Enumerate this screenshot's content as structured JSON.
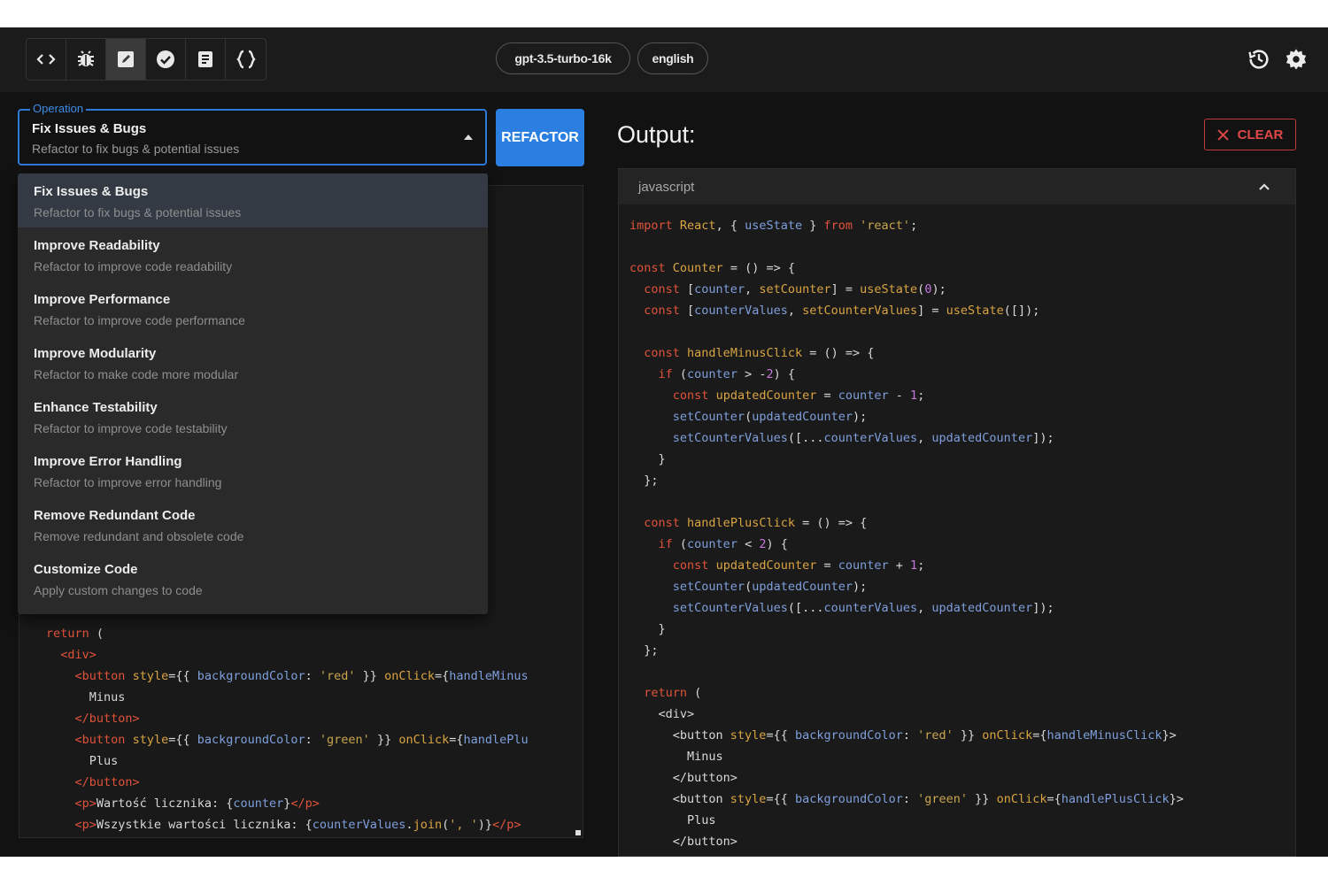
{
  "toolbar": {
    "tools": [
      {
        "icon": "code-icon"
      },
      {
        "icon": "bug-icon"
      },
      {
        "icon": "edit-icon"
      },
      {
        "icon": "check-circle-icon"
      },
      {
        "icon": "document-icon"
      },
      {
        "icon": "braces-icon"
      }
    ],
    "active_tool_index": 2,
    "model_chip": "gpt-3.5-turbo-16k",
    "language_chip": "english",
    "right_icons": [
      "history-icon",
      "gear-icon"
    ]
  },
  "operation": {
    "label": "Operation",
    "selected_title": "Fix Issues & Bugs",
    "selected_desc": "Refactor to fix bugs & potential issues",
    "button": "REFACTOR",
    "options": [
      {
        "title": "Fix Issues & Bugs",
        "desc": "Refactor to fix bugs & potential issues"
      },
      {
        "title": "Improve Readability",
        "desc": "Refactor to improve code readability"
      },
      {
        "title": "Improve Performance",
        "desc": "Refactor to improve code performance"
      },
      {
        "title": "Improve Modularity",
        "desc": "Refactor to make code more modular"
      },
      {
        "title": "Enhance Testability",
        "desc": "Refactor to improve code testability"
      },
      {
        "title": "Improve Error Handling",
        "desc": "Refactor to improve error handling"
      },
      {
        "title": "Remove Redundant Code",
        "desc": "Remove redundant and obsolete code"
      },
      {
        "title": "Customize Code",
        "desc": "Apply custom changes to code"
      }
    ]
  },
  "input_code": [
    [
      [
        "kw",
        "return"
      ],
      [
        "pl",
        " ("
      ]
    ],
    [
      [
        "pl",
        "  "
      ],
      [
        "tg",
        "<div>"
      ]
    ],
    [
      [
        "pl",
        "    "
      ],
      [
        "tg",
        "<button"
      ],
      [
        "pl",
        " "
      ],
      [
        "at",
        "style"
      ],
      [
        "pl",
        "={{ "
      ],
      [
        "vr",
        "backgroundColor"
      ],
      [
        "pl",
        ": "
      ],
      [
        "st",
        "'red'"
      ],
      [
        "pl",
        " }} "
      ],
      [
        "at",
        "onClick"
      ],
      [
        "pl",
        "={"
      ],
      [
        "vr",
        "handleMinus"
      ]
    ],
    [
      [
        "pl",
        "      Minus"
      ]
    ],
    [
      [
        "pl",
        "    "
      ],
      [
        "tg",
        "</button>"
      ]
    ],
    [
      [
        "pl",
        "    "
      ],
      [
        "tg",
        "<button"
      ],
      [
        "pl",
        " "
      ],
      [
        "at",
        "style"
      ],
      [
        "pl",
        "={{ "
      ],
      [
        "vr",
        "backgroundColor"
      ],
      [
        "pl",
        ": "
      ],
      [
        "st",
        "'green'"
      ],
      [
        "pl",
        " }} "
      ],
      [
        "at",
        "onClick"
      ],
      [
        "pl",
        "={"
      ],
      [
        "vr",
        "handlePlu"
      ]
    ],
    [
      [
        "pl",
        "      Plus"
      ]
    ],
    [
      [
        "pl",
        "    "
      ],
      [
        "tg",
        "</button>"
      ]
    ],
    [
      [
        "pl",
        "    "
      ],
      [
        "tg",
        "<p>"
      ],
      [
        "pl",
        "Wartość licznika: {"
      ],
      [
        "vr",
        "counter"
      ],
      [
        "pl",
        "}"
      ],
      [
        "tg",
        "</p>"
      ]
    ],
    [
      [
        "pl",
        "    "
      ],
      [
        "tg",
        "<p>"
      ],
      [
        "pl",
        "Wszystkie wartości licznika: {"
      ],
      [
        "vr",
        "counterValues"
      ],
      [
        "pl",
        "."
      ],
      [
        "fn",
        "join"
      ],
      [
        "pl",
        "("
      ],
      [
        "st",
        "', '"
      ],
      [
        "pl",
        ")}"
      ],
      [
        "tg",
        "</p>"
      ]
    ]
  ],
  "output": {
    "title": "Output:",
    "clear_label": "CLEAR",
    "language": "javascript",
    "code": [
      [
        [
          "kw",
          "import"
        ],
        [
          "pl",
          " "
        ],
        [
          "fn",
          "React"
        ],
        [
          "pl",
          ", { "
        ],
        [
          "vr",
          "useState"
        ],
        [
          "pl",
          " } "
        ],
        [
          "kw",
          "from"
        ],
        [
          "pl",
          " "
        ],
        [
          "st",
          "'react'"
        ],
        [
          "pl",
          ";"
        ]
      ],
      [],
      [
        [
          "kw",
          "const"
        ],
        [
          "pl",
          " "
        ],
        [
          "fn",
          "Counter"
        ],
        [
          "pl",
          " = () => {"
        ]
      ],
      [
        [
          "pl",
          "  "
        ],
        [
          "kw",
          "const"
        ],
        [
          "pl",
          " ["
        ],
        [
          "vr",
          "counter"
        ],
        [
          "pl",
          ", "
        ],
        [
          "fn",
          "setCounter"
        ],
        [
          "pl",
          "] = "
        ],
        [
          "fn",
          "useState"
        ],
        [
          "pl",
          "("
        ],
        [
          "nm",
          "0"
        ],
        [
          "pl",
          ");"
        ]
      ],
      [
        [
          "pl",
          "  "
        ],
        [
          "kw",
          "const"
        ],
        [
          "pl",
          " ["
        ],
        [
          "vr",
          "counterValues"
        ],
        [
          "pl",
          ", "
        ],
        [
          "fn",
          "setCounterValues"
        ],
        [
          "pl",
          "] = "
        ],
        [
          "fn",
          "useState"
        ],
        [
          "pl",
          "([]);"
        ]
      ],
      [],
      [
        [
          "pl",
          "  "
        ],
        [
          "kw",
          "const"
        ],
        [
          "pl",
          " "
        ],
        [
          "fn",
          "handleMinusClick"
        ],
        [
          "pl",
          " = () => {"
        ]
      ],
      [
        [
          "pl",
          "    "
        ],
        [
          "kw",
          "if"
        ],
        [
          "pl",
          " ("
        ],
        [
          "vr",
          "counter"
        ],
        [
          "pl",
          " > -"
        ],
        [
          "nm",
          "2"
        ],
        [
          "pl",
          ") {"
        ]
      ],
      [
        [
          "pl",
          "      "
        ],
        [
          "kw",
          "const"
        ],
        [
          "pl",
          " "
        ],
        [
          "fn",
          "updatedCounter"
        ],
        [
          "pl",
          " = "
        ],
        [
          "vr",
          "counter"
        ],
        [
          "pl",
          " - "
        ],
        [
          "nm",
          "1"
        ],
        [
          "pl",
          ";"
        ]
      ],
      [
        [
          "pl",
          "      "
        ],
        [
          "vr",
          "setCounter"
        ],
        [
          "pl",
          "("
        ],
        [
          "vr",
          "updatedCounter"
        ],
        [
          "pl",
          ");"
        ]
      ],
      [
        [
          "pl",
          "      "
        ],
        [
          "vr",
          "setCounterValues"
        ],
        [
          "pl",
          "([..."
        ],
        [
          "vr",
          "counterValues"
        ],
        [
          "pl",
          ", "
        ],
        [
          "vr",
          "updatedCounter"
        ],
        [
          "pl",
          "]);"
        ]
      ],
      [
        [
          "pl",
          "    }"
        ]
      ],
      [
        [
          "pl",
          "  };"
        ]
      ],
      [],
      [
        [
          "pl",
          "  "
        ],
        [
          "kw",
          "const"
        ],
        [
          "pl",
          " "
        ],
        [
          "fn",
          "handlePlusClick"
        ],
        [
          "pl",
          " = () => {"
        ]
      ],
      [
        [
          "pl",
          "    "
        ],
        [
          "kw",
          "if"
        ],
        [
          "pl",
          " ("
        ],
        [
          "vr",
          "counter"
        ],
        [
          "pl",
          " < "
        ],
        [
          "nm",
          "2"
        ],
        [
          "pl",
          ") {"
        ]
      ],
      [
        [
          "pl",
          "      "
        ],
        [
          "kw",
          "const"
        ],
        [
          "pl",
          " "
        ],
        [
          "fn",
          "updatedCounter"
        ],
        [
          "pl",
          " = "
        ],
        [
          "vr",
          "counter"
        ],
        [
          "pl",
          " + "
        ],
        [
          "nm",
          "1"
        ],
        [
          "pl",
          ";"
        ]
      ],
      [
        [
          "pl",
          "      "
        ],
        [
          "vr",
          "setCounter"
        ],
        [
          "pl",
          "("
        ],
        [
          "vr",
          "updatedCounter"
        ],
        [
          "pl",
          ");"
        ]
      ],
      [
        [
          "pl",
          "      "
        ],
        [
          "vr",
          "setCounterValues"
        ],
        [
          "pl",
          "([..."
        ],
        [
          "vr",
          "counterValues"
        ],
        [
          "pl",
          ", "
        ],
        [
          "vr",
          "updatedCounter"
        ],
        [
          "pl",
          "]);"
        ]
      ],
      [
        [
          "pl",
          "    }"
        ]
      ],
      [
        [
          "pl",
          "  };"
        ]
      ],
      [],
      [
        [
          "pl",
          "  "
        ],
        [
          "kw",
          "return"
        ],
        [
          "pl",
          " ("
        ]
      ],
      [
        [
          "pl",
          "    "
        ],
        [
          "pl",
          "<div>"
        ]
      ],
      [
        [
          "pl",
          "      <button "
        ],
        [
          "at",
          "style"
        ],
        [
          "pl",
          "={{ "
        ],
        [
          "vr",
          "backgroundColor"
        ],
        [
          "pl",
          ": "
        ],
        [
          "st",
          "'red'"
        ],
        [
          "pl",
          " }} "
        ],
        [
          "at",
          "onClick"
        ],
        [
          "pl",
          "={"
        ],
        [
          "vr",
          "handleMinusClick"
        ],
        [
          "pl",
          "}>"
        ]
      ],
      [
        [
          "pl",
          "        Minus"
        ]
      ],
      [
        [
          "pl",
          "      </button>"
        ]
      ],
      [
        [
          "pl",
          "      <button "
        ],
        [
          "at",
          "style"
        ],
        [
          "pl",
          "={{ "
        ],
        [
          "vr",
          "backgroundColor"
        ],
        [
          "pl",
          ": "
        ],
        [
          "st",
          "'green'"
        ],
        [
          "pl",
          " }} "
        ],
        [
          "at",
          "onClick"
        ],
        [
          "pl",
          "={"
        ],
        [
          "vr",
          "handlePlusClick"
        ],
        [
          "pl",
          "}>"
        ]
      ],
      [
        [
          "pl",
          "        Plus"
        ]
      ],
      [
        [
          "pl",
          "      </button>"
        ]
      ]
    ]
  },
  "colors": {
    "accent": "#2b7fe0",
    "clear": "#e04848",
    "background": "#121212"
  }
}
